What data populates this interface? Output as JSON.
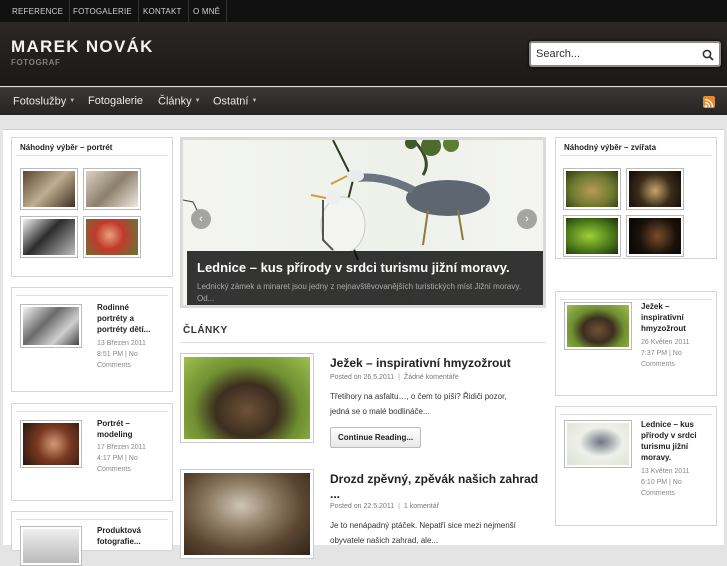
{
  "topnav": [
    "Reference",
    "Fotogalerie",
    "Kontakt",
    "O mně"
  ],
  "header": {
    "title": "MAREK NOVÁK",
    "tagline": "FOTOGRAF"
  },
  "search": {
    "placeholder": "Search..."
  },
  "mainnav": [
    {
      "label": "Fotoslužby",
      "dropdown": true
    },
    {
      "label": "Fotogalerie",
      "dropdown": false
    },
    {
      "label": "Články",
      "dropdown": true
    },
    {
      "label": "Ostatní",
      "dropdown": true
    }
  ],
  "left": {
    "random_title": "Náhodný výběr – portrét",
    "posts": [
      {
        "title_lines": [
          "Rodinné",
          "portréty a",
          "portréty dětí..."
        ],
        "date": "13 Březen 2011",
        "meta": [
          "8:51 PM | No",
          "Comments"
        ]
      },
      {
        "title_lines": [
          "Portrét –",
          "modeling"
        ],
        "date": "17 Březen 2011",
        "meta": [
          "4:17 PM | No",
          "Comments"
        ]
      },
      {
        "title_lines": [
          "Produktová",
          "fotografie..."
        ],
        "date": "",
        "meta": []
      }
    ]
  },
  "right": {
    "random_title": "Náhodný výběr – zvířata",
    "posts": [
      {
        "title_lines": [
          "Ježek –",
          "inspirativní",
          "hmyzožrout"
        ],
        "date": "26 Květen 2011",
        "meta": [
          "7:37 PM | No",
          "Comments"
        ]
      },
      {
        "title_lines": [
          "Lednice – kus",
          "přírody v srdci",
          "turismu jižní",
          "moravy."
        ],
        "date": "13 Květen 2011",
        "meta": [
          "6:10 PM | No",
          "Comments"
        ]
      }
    ]
  },
  "slider": {
    "title": "Lednice – kus přírody v srdci turismu jižní moravy.",
    "excerpt": "Lednický zámek a minaret jsou jedny z nejnavštěvovanějších turistických míst Jižní moravy. Od..."
  },
  "section_title": "ČLÁNKY",
  "articles": [
    {
      "title": "Ježek – inspirativní hmyzožrout",
      "posted": "Posted on 26.5.2011",
      "comments": "Žádné komentáře",
      "excerpt_lines": [
        "Třetihory na asfaltu…, o čem to píši? Řidiči pozor,",
        "jedná se o malé bodlináče..."
      ],
      "button": "Continue Reading..."
    },
    {
      "title_lines": [
        "Drozd zpěvný, zpěvák našich zahrad",
        "..."
      ],
      "posted": "Posted on 22.5.2011",
      "comments": "1 komentář",
      "excerpt_lines": [
        "Je to nenápadný ptáček. Nepatří sice mezi nejmenší",
        "obyvatele našich zahrad, ale..."
      ]
    }
  ],
  "colors": {
    "topbar": "#111111",
    "header": "#221f1e",
    "nav": "#2f2d2c",
    "rss": "#e8892a"
  }
}
